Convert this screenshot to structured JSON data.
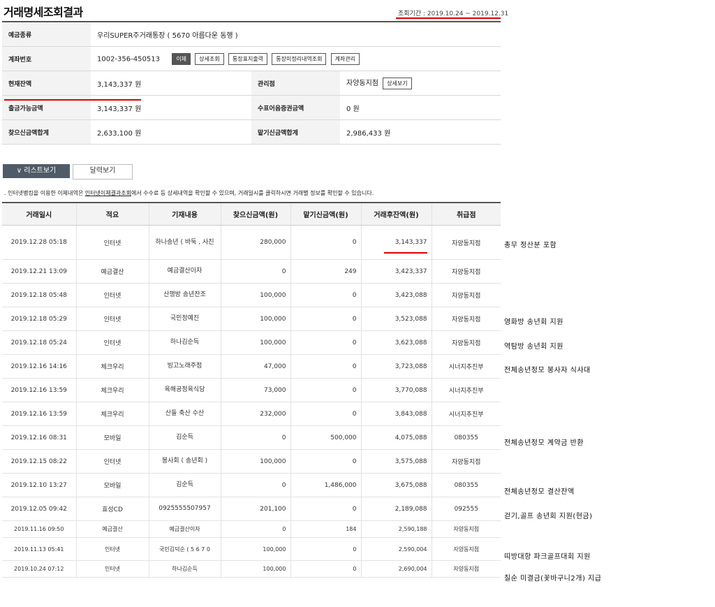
{
  "title": "거래명세조회결과",
  "period": {
    "label": "조회기간 :",
    "value": "2019.10.24 ~ 2019.12.31"
  },
  "summary": {
    "deposit_type_label": "예금종류",
    "deposit_type_value": "우리SUPER주거래통장 ( 5670 아름다운 동행 )",
    "account_label": "계좌번호",
    "account_value": "1002-356-450513",
    "account_buttons": [
      "이체",
      "상세조회",
      "통장표지출력",
      "통장미정리내역조회",
      "계좌관리"
    ],
    "balance_label": "현재잔액",
    "balance_value": "3,143,337 원",
    "branch_label": "관리점",
    "branch_value": "자양동지점",
    "branch_button": "상세보기",
    "withdrawable_label": "출금가능금액",
    "withdrawable_value": "3,143,337 원",
    "check_label": "수표어음증권금액",
    "check_value": "0 원",
    "withdraw_total_label": "찾으신금액합계",
    "withdraw_total_value": "2,633,100 원",
    "deposit_total_label": "맡기신금액합계",
    "deposit_total_value": "2,986,433 원"
  },
  "tabs": {
    "list": "리스트보기",
    "calendar": "달력보기"
  },
  "notice": {
    "prefix": ". 인터넷뱅킹을 이용한 이체내역은 ",
    "link": "인터넷이체결과조회",
    "suffix": "에서 수수료 등 상세내역을 확인할 수 있으며, 거래일시를 클릭하시면 거래별 정보를 확인할 수 있습니다."
  },
  "table": {
    "headers": [
      "거래일시",
      "적요",
      "기재내용",
      "찾으신금액(원)",
      "맡기신금액(원)",
      "거래후잔액(원)",
      "취급점"
    ],
    "rows": [
      [
        "2019.12.28 05:18",
        "인터넷",
        "하나송년 ( 바둑 , 사진",
        "280,000",
        "0",
        "3,143,337",
        "자양동지점"
      ],
      [
        "2019.12.21 13:09",
        "예금결산",
        "예금결산이자",
        "0",
        "249",
        "3,423,337",
        "자양동지점"
      ],
      [
        "2019.12.18 05:48",
        "인터넷",
        "산행방 송년잔조",
        "100,000",
        "0",
        "3,423,088",
        "자양동지점"
      ],
      [
        "2019.12.18 05:29",
        "인터넷",
        "국민정예진",
        "100,000",
        "0",
        "3,523,088",
        "자양동지점"
      ],
      [
        "2019.12.18 05:24",
        "인터넷",
        "하나김순득",
        "100,000",
        "0",
        "3,623,088",
        "자양동지점"
      ],
      [
        "2019.12.16 14:16",
        "체크우리",
        "빙고노래주점",
        "47,000",
        "0",
        "3,723,088",
        "시너지추진부"
      ],
      [
        "2019.12.16 13:59",
        "체크우리",
        "육해공정육식당",
        "73,000",
        "0",
        "3,770,088",
        "시너지추진부"
      ],
      [
        "2019.12.16 13:59",
        "체크우리",
        "산들 축산 수산",
        "232,000",
        "0",
        "3,843,088",
        "시너지추진부"
      ],
      [
        "2019.12.16 08:31",
        "모바일",
        "김순득",
        "0",
        "500,000",
        "4,075,088",
        "080355"
      ],
      [
        "2019.12.15 08:22",
        "인터넷",
        "봉사회 ( 송년회 )",
        "100,000",
        "0",
        "3,575,088",
        "자양동지점"
      ],
      [
        "2019.12.10 13:27",
        "모바일",
        "김순득",
        "0",
        "1,486,000",
        "3,675,088",
        "080355"
      ],
      [
        "2019.12.05 09:42",
        "효성CD",
        "0925555507957",
        "201,100",
        "0",
        "2,189,088",
        "092555"
      ],
      [
        "2019.11.16 09:50",
        "예금결산",
        "예금결산이자",
        "0",
        "184",
        "2,590,188",
        "자양동지점"
      ],
      [
        "2019.11.13 05:41",
        "인터넷",
        "국민김덕순 ( 5 6 7 0",
        "100,000",
        "0",
        "2,590,004",
        "자양동지점"
      ],
      [
        "2019.10.24 07:12",
        "인터넷",
        "하나김순득",
        "100,000",
        "0",
        "2,690,004",
        "자양동지점"
      ]
    ]
  },
  "memos": [
    "총무 정산분 포함",
    "영화방 송년회 지원",
    "역탐방 송년회 지원",
    "전체송년정모 봉사자 식사대",
    "전체송년정모 계약금 반환",
    "전체송년정모 결산잔액",
    "걷기,골프 송년회 지원(현금)",
    "띠방대항 파크골프대회 지원",
    "칠순 미결금(꽃바구니2개) 지급"
  ],
  "colors": {
    "highlight_red": "#e00000",
    "header_bg": "#f3f3f3",
    "tab_active": "#4f5b66"
  },
  "icons": {
    "tab_list": "chevron-down-icon"
  }
}
